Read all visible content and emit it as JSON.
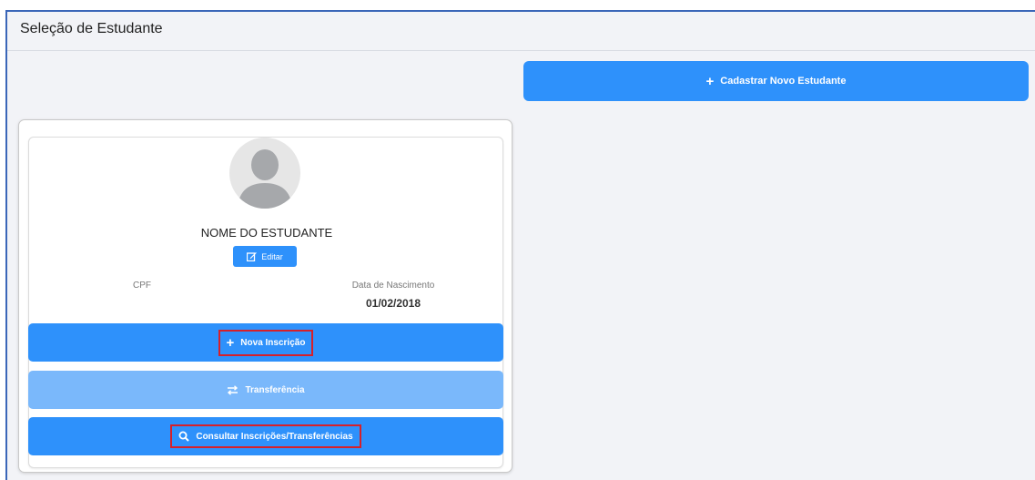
{
  "page": {
    "title": "Seleção de Estudante"
  },
  "actions": {
    "cadastrar_label": "Cadastrar Novo Estudante"
  },
  "student": {
    "name": "NOME DO ESTUDANTE",
    "edit_label": "Editar",
    "cpf_label": "CPF",
    "cpf_value": "",
    "birth_label": "Data de Nascimento",
    "birth_value": "01/02/2018"
  },
  "buttons": {
    "nova_inscricao": "Nova Inscrição",
    "transferencia": "Transferência",
    "consultar": "Consultar Inscrições/Transferências"
  },
  "icons": {
    "cadastrar": "plus-icon",
    "avatar": "user-silhouette-icon",
    "editar": "edit-icon",
    "nova_inscricao": "plus-icon",
    "transferencia": "swap-arrows-icon",
    "consultar": "search-icon"
  },
  "colors": {
    "primary": "#2e91fb",
    "primary_light": "#7ab8fb",
    "highlight_border": "#d6202a",
    "background": "#f2f3f7"
  }
}
